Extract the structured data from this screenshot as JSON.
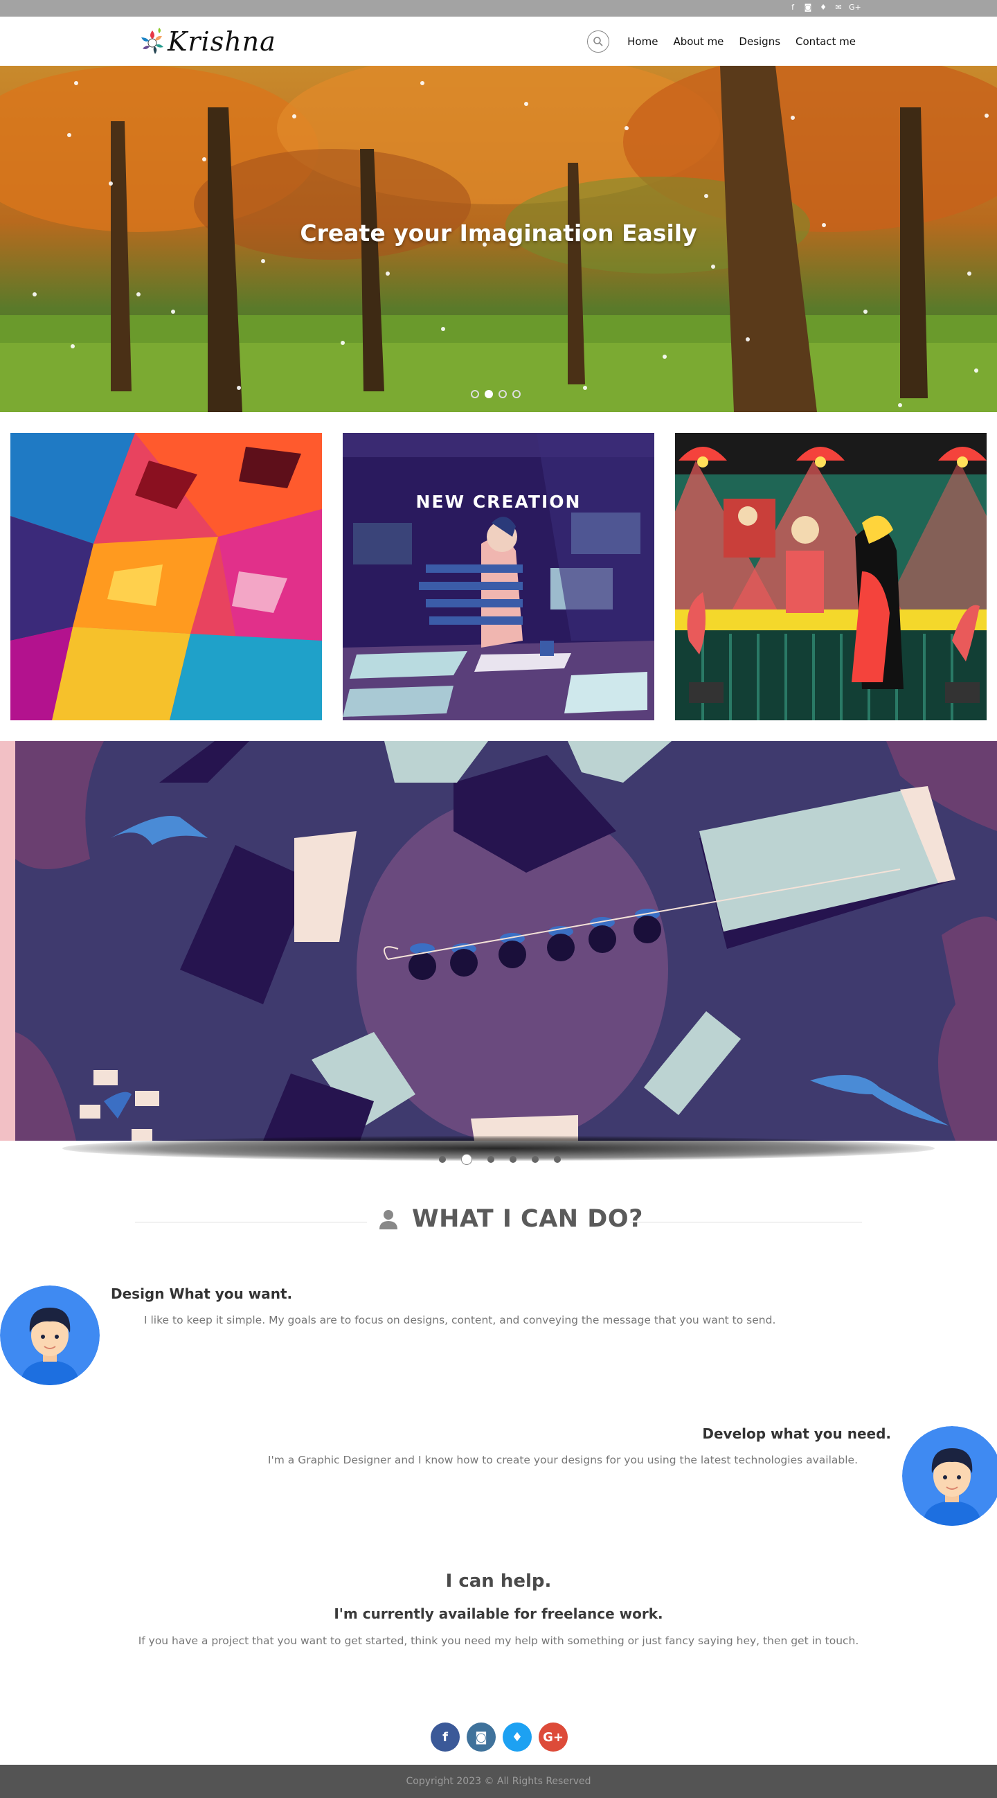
{
  "topbar": {
    "socials": [
      {
        "icon": "facebook-icon",
        "glyph": "f"
      },
      {
        "icon": "instagram-icon",
        "glyph": "◙"
      },
      {
        "icon": "twitter-icon",
        "glyph": "♦"
      },
      {
        "icon": "email-icon",
        "glyph": "✉"
      },
      {
        "icon": "google-plus-icon",
        "glyph": "G+"
      }
    ]
  },
  "header": {
    "logo_text": "Krishna",
    "nav": [
      {
        "label": "Home"
      },
      {
        "label": "About me"
      },
      {
        "label": "Designs"
      },
      {
        "label": "Contact me"
      }
    ]
  },
  "hero": {
    "title": "Create your Imagination Easily",
    "slides": 4,
    "active_slide": 1
  },
  "tiles": {
    "caption_2": "NEW CREATION"
  },
  "banner": {
    "slides": 6,
    "active_slide": 1
  },
  "section": {
    "heading": "WHAT I CAN DO?"
  },
  "features": [
    {
      "title": "Design What you want.",
      "text": "I like to keep it simple. My goals are to focus on designs, content, and conveying the message that you want to send."
    },
    {
      "title": "Develop what you need.",
      "text": "I'm a Graphic Designer and I know how to create your designs for you using the latest technologies available."
    }
  ],
  "help": {
    "title": "I can help.",
    "subtitle": "I'm currently available for freelance work.",
    "text": "If you have a project that you want to get started, think you need my help with something or just fancy saying hey, then get in touch."
  },
  "footer_social": [
    {
      "icon": "facebook-icon",
      "glyph": "f",
      "color": "#3b5998"
    },
    {
      "icon": "instagram-icon",
      "glyph": "◙",
      "color": "#3f729b"
    },
    {
      "icon": "twitter-icon",
      "glyph": "♦",
      "color": "#1da1f2"
    },
    {
      "icon": "google-plus-icon",
      "glyph": "G+",
      "color": "#dd4b39"
    }
  ],
  "footer": {
    "copyright": "Copyright 2023 © All Rights Reserved"
  },
  "colors": {
    "topbar": "#a3a3a3",
    "footer": "#545454",
    "heading": "#5a5a5a"
  }
}
